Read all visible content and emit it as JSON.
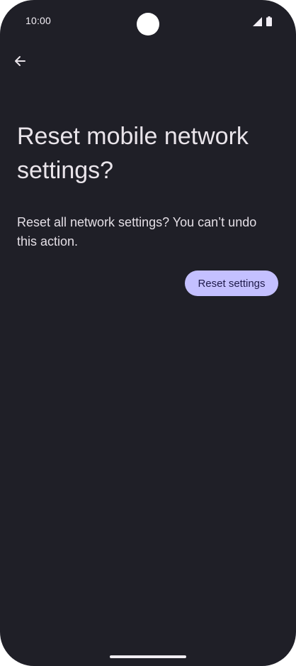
{
  "status_bar": {
    "time": "10:00",
    "signal_icon": "cellular-signal-icon",
    "battery_icon": "battery-icon"
  },
  "header": {
    "back_icon": "arrow-back-icon"
  },
  "main": {
    "title": "Reset mobile network settings?",
    "description": "Reset all network settings? You can’t undo this action.",
    "reset_button_label": "Reset settings"
  },
  "colors": {
    "background": "#1f1f27",
    "button": "#c4c0ff",
    "button_text": "#1f1b4a",
    "text": "#e6e1e6"
  }
}
